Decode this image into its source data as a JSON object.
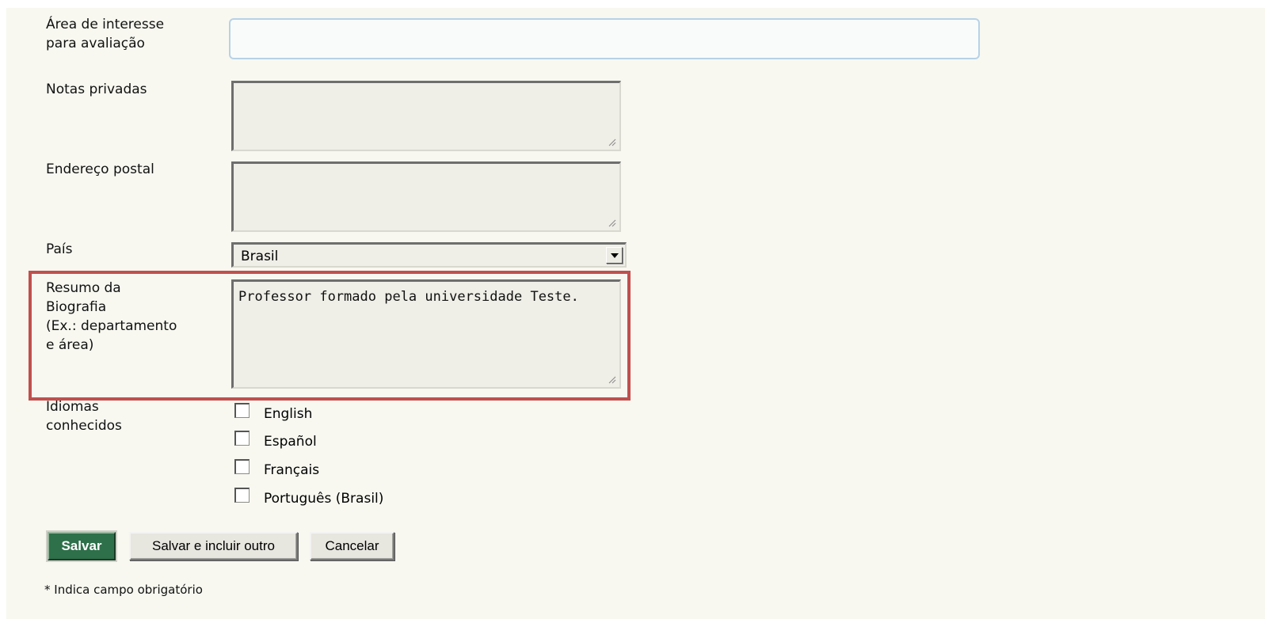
{
  "form": {
    "interest_label": "Área de interesse\npara avaliação",
    "interest_value": "",
    "private_notes_label": "Notas privadas",
    "private_notes_value": "",
    "postal_address_label": "Endereço postal",
    "postal_address_value": "",
    "country_label": "País",
    "country_value": "Brasil",
    "bio_label": "Resumo da\nBiografia\n(Ex.: departamento\ne área)",
    "bio_value": "Professor formado pela universidade Teste.",
    "languages_label": "Idiomas\nconhecidos",
    "languages": [
      {
        "label": "English",
        "checked": false
      },
      {
        "label": "Español",
        "checked": false
      },
      {
        "label": "Français",
        "checked": false
      },
      {
        "label": "Português (Brasil)",
        "checked": false
      }
    ]
  },
  "actions": {
    "save_label": "Salvar",
    "save_and_add_label": "Salvar e incluir outro",
    "cancel_label": "Cancelar"
  },
  "required_note": "* Indica campo obrigatório",
  "colors": {
    "highlight": "#c0504d",
    "primary_button": "#2d7049",
    "panel_background": "#f8f8f1"
  }
}
